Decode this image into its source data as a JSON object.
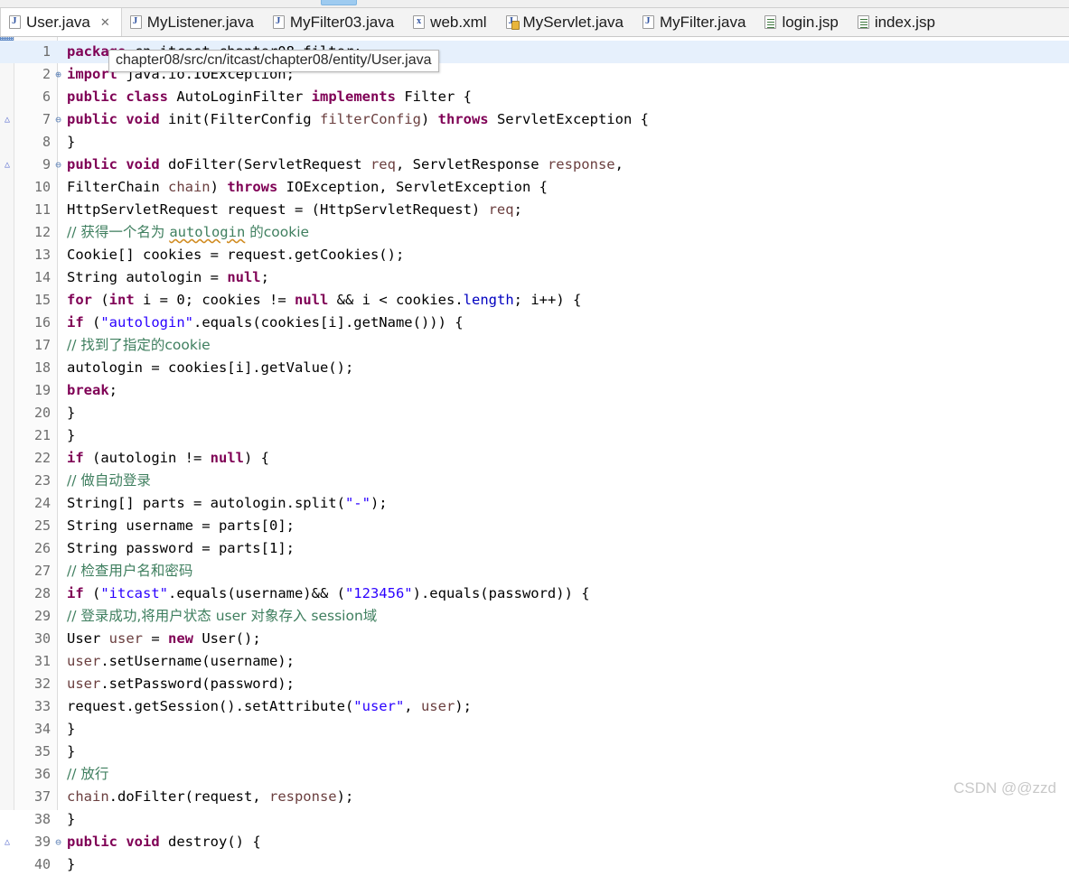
{
  "toolbar": {
    "active_chip": "toolbar-active-item"
  },
  "tabs": [
    {
      "label": "User.java",
      "icon": "java-file-icon",
      "active": true,
      "close": "✕"
    },
    {
      "label": "MyListener.java",
      "icon": "java-file-icon",
      "active": false,
      "close": ""
    },
    {
      "label": "MyFilter03.java",
      "icon": "java-file-icon",
      "active": false,
      "close": ""
    },
    {
      "label": "web.xml",
      "icon": "xml-file-icon",
      "active": false,
      "close": ""
    },
    {
      "label": "MyServlet.java",
      "icon": "java-warn-icon",
      "active": false,
      "close": ""
    },
    {
      "label": "MyFilter.java",
      "icon": "java-file-icon",
      "active": false,
      "close": ""
    },
    {
      "label": "login.jsp",
      "icon": "jsp-file-icon",
      "active": false,
      "close": ""
    },
    {
      "label": "index.jsp",
      "icon": "jsp-file-icon",
      "active": false,
      "close": ""
    }
  ],
  "tooltip": {
    "text": "chapter08/src/cn/itcast/chapter08/entity/User.java"
  },
  "watermark": {
    "text": "CSDN @@zzd"
  },
  "editor": {
    "current_line": 1,
    "lines": [
      {
        "n": "1",
        "fold": "",
        "ovr": "",
        "current": true,
        "tokens": [
          {
            "t": "package",
            "c": "kw"
          },
          {
            "t": " cn.itcast.chapter08.filter;",
            "c": "plain"
          }
        ]
      },
      {
        "n": "2",
        "fold": "⊕",
        "ovr": "",
        "tokens": [
          {
            "t": "import",
            "c": "kw"
          },
          {
            "t": " java.io.IOException;",
            "c": "plain"
          }
        ]
      },
      {
        "n": "6",
        "fold": "",
        "ovr": "",
        "tokens": [
          {
            "t": "public",
            "c": "kw"
          },
          {
            "t": " ",
            "c": "plain"
          },
          {
            "t": "class",
            "c": "kw"
          },
          {
            "t": " AutoLoginFilter ",
            "c": "plain"
          },
          {
            "t": "implements",
            "c": "kw"
          },
          {
            "t": " Filter {",
            "c": "plain"
          }
        ]
      },
      {
        "n": "7",
        "fold": "⊖",
        "ovr": "△",
        "tokens": [
          {
            "t": "    ",
            "c": "plain"
          },
          {
            "t": "public",
            "c": "kw"
          },
          {
            "t": " ",
            "c": "plain"
          },
          {
            "t": "void",
            "c": "kw"
          },
          {
            "t": " init(FilterConfig ",
            "c": "plain"
          },
          {
            "t": "filterConfig",
            "c": "par"
          },
          {
            "t": ") ",
            "c": "plain"
          },
          {
            "t": "throws",
            "c": "kw"
          },
          {
            "t": " ServletException {",
            "c": "plain"
          }
        ]
      },
      {
        "n": "8",
        "fold": "",
        "ovr": "",
        "tokens": [
          {
            "t": "    }",
            "c": "plain"
          }
        ]
      },
      {
        "n": "9",
        "fold": "⊖",
        "ovr": "△",
        "tokens": [
          {
            "t": "    ",
            "c": "plain"
          },
          {
            "t": "public",
            "c": "kw"
          },
          {
            "t": " ",
            "c": "plain"
          },
          {
            "t": "void",
            "c": "kw"
          },
          {
            "t": " doFilter(ServletRequest ",
            "c": "plain"
          },
          {
            "t": "req",
            "c": "par"
          },
          {
            "t": ", ServletResponse ",
            "c": "plain"
          },
          {
            "t": "response",
            "c": "par"
          },
          {
            "t": ",",
            "c": "plain"
          }
        ]
      },
      {
        "n": "10",
        "fold": "",
        "ovr": "",
        "tokens": [
          {
            "t": "            FilterChain ",
            "c": "plain"
          },
          {
            "t": "chain",
            "c": "par"
          },
          {
            "t": ") ",
            "c": "plain"
          },
          {
            "t": "throws",
            "c": "kw"
          },
          {
            "t": " IOException, ServletException {",
            "c": "plain"
          }
        ]
      },
      {
        "n": "11",
        "fold": "",
        "ovr": "",
        "tokens": [
          {
            "t": "        HttpServletRequest request = (HttpServletRequest) ",
            "c": "plain"
          },
          {
            "t": "req",
            "c": "par"
          },
          {
            "t": ";",
            "c": "plain"
          }
        ]
      },
      {
        "n": "12",
        "fold": "",
        "ovr": "",
        "tokens": [
          {
            "t": "        // 获得一个名为 ",
            "c": "cmt"
          },
          {
            "t": "autologin",
            "c": "cmt squig"
          },
          {
            "t": " 的cookie",
            "c": "cmt"
          }
        ]
      },
      {
        "n": "13",
        "fold": "",
        "ovr": "",
        "tokens": [
          {
            "t": "        Cookie[] cookies = request.getCookies();",
            "c": "plain"
          }
        ]
      },
      {
        "n": "14",
        "fold": "",
        "ovr": "",
        "tokens": [
          {
            "t": "        String autologin = ",
            "c": "plain"
          },
          {
            "t": "null",
            "c": "kw"
          },
          {
            "t": ";",
            "c": "plain"
          }
        ]
      },
      {
        "n": "15",
        "fold": "",
        "ovr": "",
        "tokens": [
          {
            "t": "        ",
            "c": "plain"
          },
          {
            "t": "for",
            "c": "kw"
          },
          {
            "t": " (",
            "c": "plain"
          },
          {
            "t": "int",
            "c": "kw"
          },
          {
            "t": " i = ",
            "c": "plain"
          },
          {
            "t": "0",
            "c": "plain"
          },
          {
            "t": "; cookies != ",
            "c": "plain"
          },
          {
            "t": "null",
            "c": "kw"
          },
          {
            "t": " && i < cookies.",
            "c": "plain"
          },
          {
            "t": "length",
            "c": "fld"
          },
          {
            "t": "; i++) {",
            "c": "plain"
          }
        ]
      },
      {
        "n": "16",
        "fold": "",
        "ovr": "",
        "tokens": [
          {
            "t": "            ",
            "c": "plain"
          },
          {
            "t": "if",
            "c": "kw"
          },
          {
            "t": " (",
            "c": "plain"
          },
          {
            "t": "\"autologin\"",
            "c": "str"
          },
          {
            "t": ".equals(cookies[i].getName())) {",
            "c": "plain"
          }
        ]
      },
      {
        "n": "17",
        "fold": "",
        "ovr": "",
        "tokens": [
          {
            "t": "                // 找到了指定的cookie",
            "c": "cmt"
          }
        ]
      },
      {
        "n": "18",
        "fold": "",
        "ovr": "",
        "tokens": [
          {
            "t": "                autologin = cookies[i].getValue();",
            "c": "plain"
          }
        ]
      },
      {
        "n": "19",
        "fold": "",
        "ovr": "",
        "tokens": [
          {
            "t": "                ",
            "c": "plain"
          },
          {
            "t": "break",
            "c": "kw"
          },
          {
            "t": ";",
            "c": "plain"
          }
        ]
      },
      {
        "n": "20",
        "fold": "",
        "ovr": "",
        "tokens": [
          {
            "t": "            }",
            "c": "plain"
          }
        ]
      },
      {
        "n": "21",
        "fold": "",
        "ovr": "",
        "tokens": [
          {
            "t": "        }",
            "c": "plain"
          }
        ]
      },
      {
        "n": "22",
        "fold": "",
        "ovr": "",
        "tokens": [
          {
            "t": "        ",
            "c": "plain"
          },
          {
            "t": "if",
            "c": "kw"
          },
          {
            "t": " (autologin != ",
            "c": "plain"
          },
          {
            "t": "null",
            "c": "kw"
          },
          {
            "t": ") {",
            "c": "plain"
          }
        ]
      },
      {
        "n": "23",
        "fold": "",
        "ovr": "",
        "tokens": [
          {
            "t": "            // 做自动登录",
            "c": "cmt"
          }
        ]
      },
      {
        "n": "24",
        "fold": "",
        "ovr": "",
        "tokens": [
          {
            "t": "            String[] parts = autologin.split(",
            "c": "plain"
          },
          {
            "t": "\"-\"",
            "c": "str"
          },
          {
            "t": ");",
            "c": "plain"
          }
        ]
      },
      {
        "n": "25",
        "fold": "",
        "ovr": "",
        "tokens": [
          {
            "t": "            String username = parts[",
            "c": "plain"
          },
          {
            "t": "0",
            "c": "plain"
          },
          {
            "t": "];",
            "c": "plain"
          }
        ]
      },
      {
        "n": "26",
        "fold": "",
        "ovr": "",
        "tokens": [
          {
            "t": "            String password = parts[",
            "c": "plain"
          },
          {
            "t": "1",
            "c": "plain"
          },
          {
            "t": "];",
            "c": "plain"
          }
        ]
      },
      {
        "n": "27",
        "fold": "",
        "ovr": "",
        "tokens": [
          {
            "t": "            // 检查用户名和密码",
            "c": "cmt"
          }
        ]
      },
      {
        "n": "28",
        "fold": "",
        "ovr": "",
        "tokens": [
          {
            "t": "            ",
            "c": "plain"
          },
          {
            "t": "if",
            "c": "kw"
          },
          {
            "t": " (",
            "c": "plain"
          },
          {
            "t": "\"itcast\"",
            "c": "str"
          },
          {
            "t": ".equals(username)&& (",
            "c": "plain"
          },
          {
            "t": "\"123456\"",
            "c": "str"
          },
          {
            "t": ").equals(password)) {",
            "c": "plain"
          }
        ]
      },
      {
        "n": "29",
        "fold": "",
        "ovr": "",
        "tokens": [
          {
            "t": "                // 登录成功,将用户状态 user 对象存入 session域",
            "c": "cmt"
          }
        ]
      },
      {
        "n": "30",
        "fold": "",
        "ovr": "",
        "tokens": [
          {
            "t": "                User ",
            "c": "plain"
          },
          {
            "t": "user",
            "c": "par"
          },
          {
            "t": " = ",
            "c": "plain"
          },
          {
            "t": "new",
            "c": "kw"
          },
          {
            "t": " User();",
            "c": "plain"
          }
        ]
      },
      {
        "n": "31",
        "fold": "",
        "ovr": "",
        "tokens": [
          {
            "t": "                ",
            "c": "plain"
          },
          {
            "t": "user",
            "c": "par"
          },
          {
            "t": ".setUsername(username);",
            "c": "plain"
          }
        ]
      },
      {
        "n": "32",
        "fold": "",
        "ovr": "",
        "tokens": [
          {
            "t": "                ",
            "c": "plain"
          },
          {
            "t": "user",
            "c": "par"
          },
          {
            "t": ".setPassword(password);",
            "c": "plain"
          }
        ]
      },
      {
        "n": "33",
        "fold": "",
        "ovr": "",
        "tokens": [
          {
            "t": "                request.getSession().setAttribute(",
            "c": "plain"
          },
          {
            "t": "\"user\"",
            "c": "str"
          },
          {
            "t": ", ",
            "c": "plain"
          },
          {
            "t": "user",
            "c": "par"
          },
          {
            "t": ");",
            "c": "plain"
          }
        ]
      },
      {
        "n": "34",
        "fold": "",
        "ovr": "",
        "tokens": [
          {
            "t": "            }",
            "c": "plain"
          }
        ]
      },
      {
        "n": "35",
        "fold": "",
        "ovr": "",
        "tokens": [
          {
            "t": "        }",
            "c": "plain"
          }
        ]
      },
      {
        "n": "36",
        "fold": "",
        "ovr": "",
        "tokens": [
          {
            "t": "        // 放行",
            "c": "cmt"
          }
        ]
      },
      {
        "n": "37",
        "fold": "",
        "ovr": "",
        "tokens": [
          {
            "t": "        ",
            "c": "plain"
          },
          {
            "t": "chain",
            "c": "par"
          },
          {
            "t": ".doFilter(request, ",
            "c": "plain"
          },
          {
            "t": "response",
            "c": "par"
          },
          {
            "t": ");",
            "c": "plain"
          }
        ]
      },
      {
        "n": "38",
        "fold": "",
        "ovr": "",
        "tokens": [
          {
            "t": "    }",
            "c": "plain"
          }
        ]
      },
      {
        "n": "39",
        "fold": "⊖",
        "ovr": "△",
        "tokens": [
          {
            "t": "    ",
            "c": "plain"
          },
          {
            "t": "public",
            "c": "kw"
          },
          {
            "t": " ",
            "c": "plain"
          },
          {
            "t": "void",
            "c": "kw"
          },
          {
            "t": " destroy() {",
            "c": "plain"
          }
        ]
      },
      {
        "n": "40",
        "fold": "",
        "ovr": "",
        "tokens": [
          {
            "t": "    }",
            "c": "plain"
          }
        ]
      }
    ]
  },
  "colors": {
    "keyword": "#7f0055",
    "string": "#2a00ff",
    "comment": "#3f7f5f",
    "field": "#0000c0",
    "parameter": "#6a3e3e",
    "current_line_bg": "#e6f0fc",
    "tab_active_bg": "#ffffff",
    "tabbar_bg": "#f3f3f3"
  }
}
